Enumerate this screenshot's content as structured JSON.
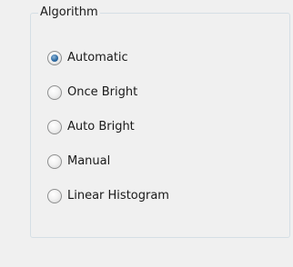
{
  "group": {
    "title": "Algorithm"
  },
  "options": [
    {
      "label": "Automatic",
      "checked": true
    },
    {
      "label": "Once Bright",
      "checked": false
    },
    {
      "label": "Auto Bright",
      "checked": false
    },
    {
      "label": "Manual",
      "checked": false
    },
    {
      "label": "Linear Histogram",
      "checked": false
    }
  ]
}
